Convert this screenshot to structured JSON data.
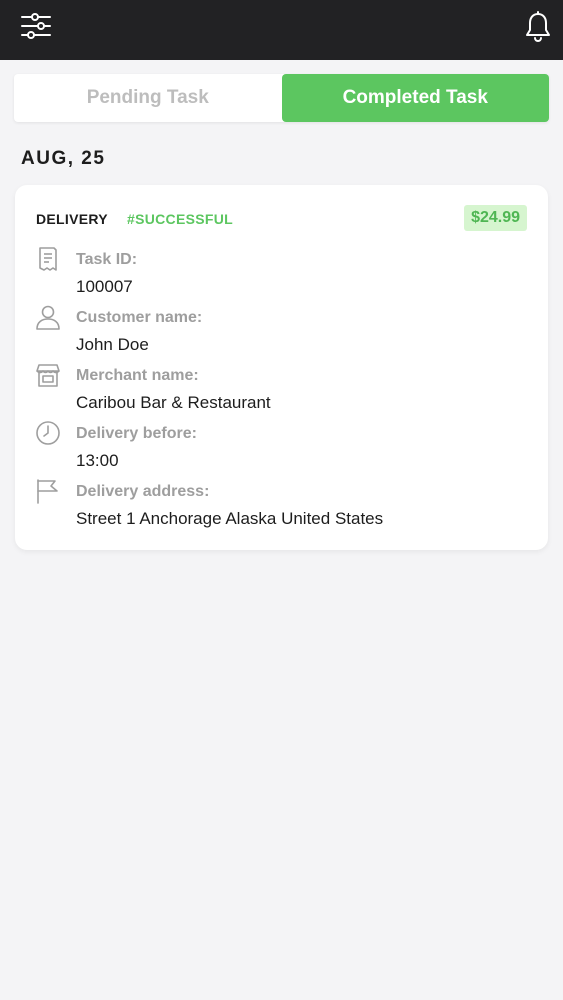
{
  "header": {
    "filter_icon": "sliders-icon",
    "notification_icon": "bell-icon"
  },
  "tabs": [
    {
      "label": "Pending Task",
      "active": false
    },
    {
      "label": "Completed Task",
      "active": true
    }
  ],
  "date": "AUG, 25",
  "task": {
    "type": "DELIVERY",
    "status": "#SUCCESSFUL",
    "price": "$24.99",
    "fields": [
      {
        "icon": "document-icon",
        "label": "Task ID:",
        "value": "100007"
      },
      {
        "icon": "user-icon",
        "label": "Customer name:",
        "value": "John Doe"
      },
      {
        "icon": "store-icon",
        "label": "Merchant name:",
        "value": "Caribou Bar & Restaurant"
      },
      {
        "icon": "clock-icon",
        "label": "Delivery before:",
        "value": "13:00"
      },
      {
        "icon": "flag-icon",
        "label": "Delivery address:",
        "value": "Street 1 Anchorage Alaska United States"
      }
    ]
  },
  "colors": {
    "header_bg": "#222224",
    "accent_green": "#5cc660",
    "price_badge_bg": "#d6f5cf",
    "label_gray": "#9e9e9e"
  }
}
